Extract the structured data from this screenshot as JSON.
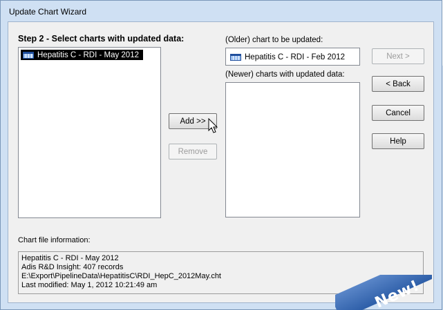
{
  "window": {
    "title": "Update Chart Wizard"
  },
  "step": {
    "title": "Step 2 - Select charts with updated data:"
  },
  "available_list": {
    "items": [
      {
        "label": "Hepatitis C - RDI - May 2012",
        "selected": true,
        "icon": "grid-icon"
      }
    ]
  },
  "older_chart": {
    "label": "(Older) chart to be updated:",
    "value": "Hepatitis C - RDI - Feb 2012",
    "icon": "grid-icon"
  },
  "newer_charts": {
    "label": "(Newer) charts with updated data:",
    "items": []
  },
  "buttons": {
    "add": "Add >>",
    "remove": "Remove",
    "next": "Next >",
    "back": "< Back",
    "cancel": "Cancel",
    "help": "Help"
  },
  "info": {
    "label": "Chart file information:",
    "lines": [
      "Hepatitis C - RDI - May 2012",
      "Adis R&D Insight: 407 records",
      "E:\\Export\\PipelineData\\HepatitisC\\RDI_HepC_2012May.cht",
      "Last modified: May 1, 2012 10:21:49 am"
    ]
  },
  "badge": {
    "text": "New!"
  },
  "colors": {
    "window_frame": "#cfe0f3",
    "client_bg": "#f0f0f0",
    "badge": "#3a6db5"
  }
}
